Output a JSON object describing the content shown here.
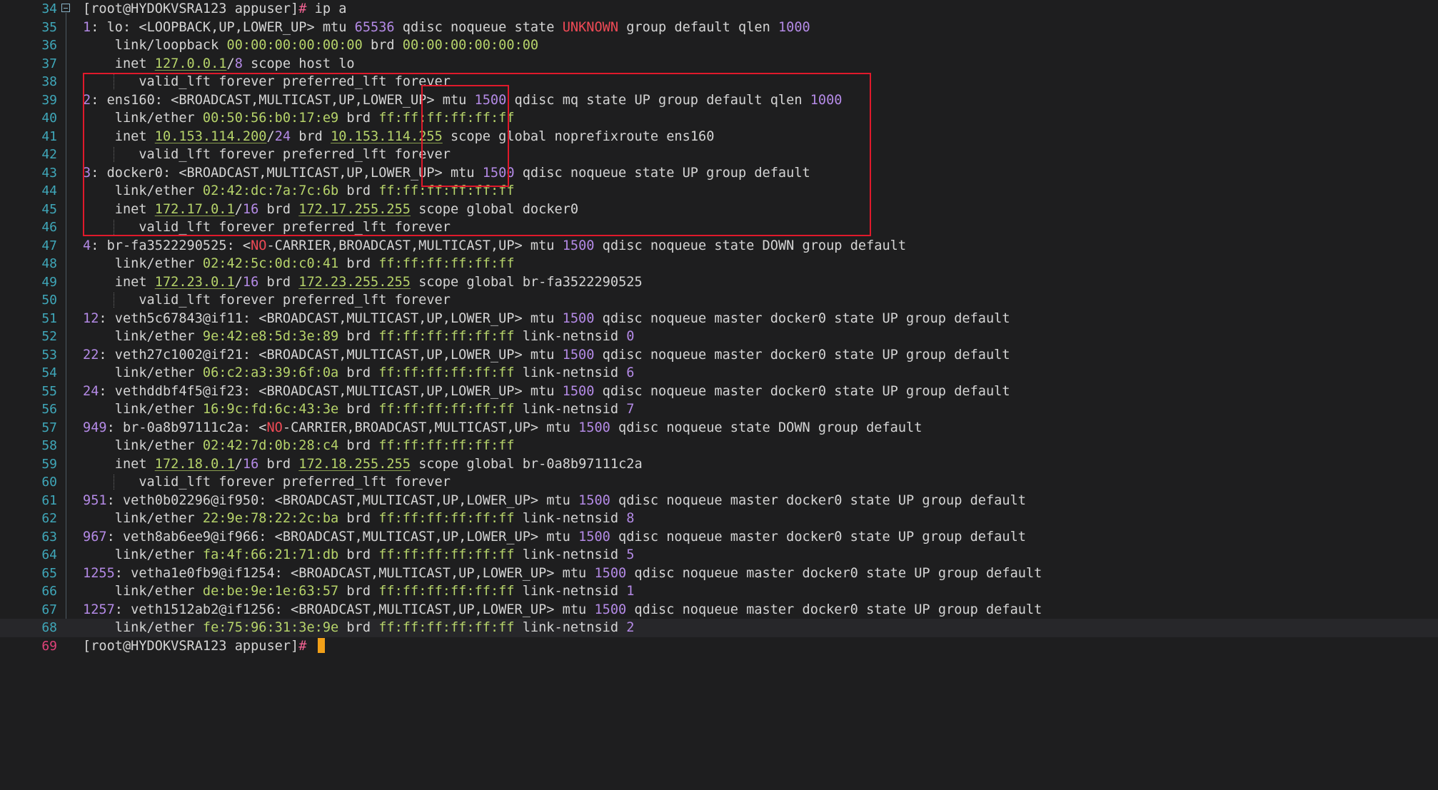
{
  "editor": {
    "first_line_number": 34,
    "current_line": 69,
    "highlight_line": 68,
    "lines": [
      [
        [
          "[root@HYDOKVSRA123 appuser]",
          "plain"
        ],
        [
          "# ",
          "pink"
        ],
        [
          "ip a",
          "plain"
        ]
      ],
      [
        [
          "1",
          "num"
        ],
        [
          ": lo: <LOOPBACK,UP,LOWER_UP> mtu ",
          "plain"
        ],
        [
          "65536",
          "num"
        ],
        [
          " qdisc noqueue state ",
          "plain"
        ],
        [
          "UNKNOWN",
          "red"
        ],
        [
          " group default qlen ",
          "plain"
        ],
        [
          "1000",
          "num"
        ]
      ],
      [
        [
          "    link/loopback ",
          "plain"
        ],
        [
          "00:00:00:00:00:00",
          "mac"
        ],
        [
          " brd ",
          "plain"
        ],
        [
          "00:00:00:00:00:00",
          "mac"
        ]
      ],
      [
        [
          "    inet ",
          "plain"
        ],
        [
          "127.0.0.1",
          "ip"
        ],
        [
          "/",
          "plain"
        ],
        [
          "8",
          "num"
        ],
        [
          " scope host lo",
          "plain"
        ]
      ],
      [
        [
          "       valid_lft forever preferred_lft forever",
          "plain"
        ]
      ],
      [
        [
          "2",
          "num"
        ],
        [
          ": ens160: <BROADCAST,MULTICAST,UP,LOWER_UP> mtu ",
          "plain"
        ],
        [
          "1500",
          "num"
        ],
        [
          " qdisc mq state UP group default qlen ",
          "plain"
        ],
        [
          "1000",
          "num"
        ]
      ],
      [
        [
          "    link/ether ",
          "plain"
        ],
        [
          "00:50:56:b0:17:e9",
          "mac"
        ],
        [
          " brd ",
          "plain"
        ],
        [
          "ff:ff:ff:ff:ff:ff",
          "mac"
        ]
      ],
      [
        [
          "    inet ",
          "plain"
        ],
        [
          "10.153.114.200",
          "ip"
        ],
        [
          "/",
          "plain"
        ],
        [
          "24",
          "num"
        ],
        [
          " brd ",
          "plain"
        ],
        [
          "10.153.114.255",
          "ip"
        ],
        [
          " scope global noprefixroute ens160",
          "plain"
        ]
      ],
      [
        [
          "       valid_lft forever preferred_lft forever",
          "plain"
        ]
      ],
      [
        [
          "3",
          "num"
        ],
        [
          ": docker0: <BROADCAST,MULTICAST,UP,LOWER_UP> mtu ",
          "plain"
        ],
        [
          "1500",
          "num"
        ],
        [
          " qdisc noqueue state UP group default",
          "plain"
        ]
      ],
      [
        [
          "    link/ether ",
          "plain"
        ],
        [
          "02:42:dc:7a:7c:6b",
          "mac"
        ],
        [
          " brd ",
          "plain"
        ],
        [
          "ff:ff:ff:ff:ff:ff",
          "mac"
        ]
      ],
      [
        [
          "    inet ",
          "plain"
        ],
        [
          "172.17.0.1",
          "ip"
        ],
        [
          "/",
          "plain"
        ],
        [
          "16",
          "num"
        ],
        [
          " brd ",
          "plain"
        ],
        [
          "172.17.255.255",
          "ip"
        ],
        [
          " scope global docker0",
          "plain"
        ]
      ],
      [
        [
          "       valid_lft forever preferred_lft forever",
          "plain"
        ]
      ],
      [
        [
          "4",
          "num"
        ],
        [
          ": br-fa3522290525: <",
          "plain"
        ],
        [
          "NO",
          "red"
        ],
        [
          "-CARRIER,BROADCAST,MULTICAST,UP> mtu ",
          "plain"
        ],
        [
          "1500",
          "num"
        ],
        [
          " qdisc noqueue state DOWN group default",
          "plain"
        ]
      ],
      [
        [
          "    link/ether ",
          "plain"
        ],
        [
          "02:42:5c:0d:c0:41",
          "mac"
        ],
        [
          " brd ",
          "plain"
        ],
        [
          "ff:ff:ff:ff:ff:ff",
          "mac"
        ]
      ],
      [
        [
          "    inet ",
          "plain"
        ],
        [
          "172.23.0.1",
          "ip"
        ],
        [
          "/",
          "plain"
        ],
        [
          "16",
          "num"
        ],
        [
          " brd ",
          "plain"
        ],
        [
          "172.23.255.255",
          "ip"
        ],
        [
          " scope global br-fa3522290525",
          "plain"
        ]
      ],
      [
        [
          "       valid_lft forever preferred_lft forever",
          "plain"
        ]
      ],
      [
        [
          "12",
          "num"
        ],
        [
          ": veth5c67843@if11: <BROADCAST,MULTICAST,UP,LOWER_UP> mtu ",
          "plain"
        ],
        [
          "1500",
          "num"
        ],
        [
          " qdisc noqueue master docker0 state UP group default",
          "plain"
        ]
      ],
      [
        [
          "    link/ether ",
          "plain"
        ],
        [
          "9e:42:e8:5d:3e:89",
          "mac"
        ],
        [
          " brd ",
          "plain"
        ],
        [
          "ff:ff:ff:ff:ff:ff",
          "mac"
        ],
        [
          " link-netnsid ",
          "plain"
        ],
        [
          "0",
          "num"
        ]
      ],
      [
        [
          "22",
          "num"
        ],
        [
          ": veth27c1002@if21: <BROADCAST,MULTICAST,UP,LOWER_UP> mtu ",
          "plain"
        ],
        [
          "1500",
          "num"
        ],
        [
          " qdisc noqueue master docker0 state UP group default",
          "plain"
        ]
      ],
      [
        [
          "    link/ether ",
          "plain"
        ],
        [
          "06:c2:a3:39:6f:0a",
          "mac"
        ],
        [
          " brd ",
          "plain"
        ],
        [
          "ff:ff:ff:ff:ff:ff",
          "mac"
        ],
        [
          " link-netnsid ",
          "plain"
        ],
        [
          "6",
          "num"
        ]
      ],
      [
        [
          "24",
          "num"
        ],
        [
          ": vethddbf4f5@if23: <BROADCAST,MULTICAST,UP,LOWER_UP> mtu ",
          "plain"
        ],
        [
          "1500",
          "num"
        ],
        [
          " qdisc noqueue master docker0 state UP group default",
          "plain"
        ]
      ],
      [
        [
          "    link/ether ",
          "plain"
        ],
        [
          "16:9c:fd:6c:43:3e",
          "mac"
        ],
        [
          " brd ",
          "plain"
        ],
        [
          "ff:ff:ff:ff:ff:ff",
          "mac"
        ],
        [
          " link-netnsid ",
          "plain"
        ],
        [
          "7",
          "num"
        ]
      ],
      [
        [
          "949",
          "num"
        ],
        [
          ": br-0a8b97111c2a: <",
          "plain"
        ],
        [
          "NO",
          "red"
        ],
        [
          "-CARRIER,BROADCAST,MULTICAST,UP> mtu ",
          "plain"
        ],
        [
          "1500",
          "num"
        ],
        [
          " qdisc noqueue state DOWN group default",
          "plain"
        ]
      ],
      [
        [
          "    link/ether ",
          "plain"
        ],
        [
          "02:42:7d:0b:28:c4",
          "mac"
        ],
        [
          " brd ",
          "plain"
        ],
        [
          "ff:ff:ff:ff:ff:ff",
          "mac"
        ]
      ],
      [
        [
          "    inet ",
          "plain"
        ],
        [
          "172.18.0.1",
          "ip"
        ],
        [
          "/",
          "plain"
        ],
        [
          "16",
          "num"
        ],
        [
          " brd ",
          "plain"
        ],
        [
          "172.18.255.255",
          "ip"
        ],
        [
          " scope global br-0a8b97111c2a",
          "plain"
        ]
      ],
      [
        [
          "       valid_lft forever preferred_lft forever",
          "plain"
        ]
      ],
      [
        [
          "951",
          "num"
        ],
        [
          ": veth0b02296@if950: <BROADCAST,MULTICAST,UP,LOWER_UP> mtu ",
          "plain"
        ],
        [
          "1500",
          "num"
        ],
        [
          " qdisc noqueue master docker0 state UP group default",
          "plain"
        ]
      ],
      [
        [
          "    link/ether ",
          "plain"
        ],
        [
          "22:9e:78:22:2c:ba",
          "mac"
        ],
        [
          " brd ",
          "plain"
        ],
        [
          "ff:ff:ff:ff:ff:ff",
          "mac"
        ],
        [
          " link-netnsid ",
          "plain"
        ],
        [
          "8",
          "num"
        ]
      ],
      [
        [
          "967",
          "num"
        ],
        [
          ": veth8ab6ee9@if966: <BROADCAST,MULTICAST,UP,LOWER_UP> mtu ",
          "plain"
        ],
        [
          "1500",
          "num"
        ],
        [
          " qdisc noqueue master docker0 state UP group default",
          "plain"
        ]
      ],
      [
        [
          "    link/ether ",
          "plain"
        ],
        [
          "fa:4f:66:21:71:db",
          "mac"
        ],
        [
          " brd ",
          "plain"
        ],
        [
          "ff:ff:ff:ff:ff:ff",
          "mac"
        ],
        [
          " link-netnsid ",
          "plain"
        ],
        [
          "5",
          "num"
        ]
      ],
      [
        [
          "1255",
          "num"
        ],
        [
          ": vetha1e0fb9@if1254: <BROADCAST,MULTICAST,UP,LOWER_UP> mtu ",
          "plain"
        ],
        [
          "1500",
          "num"
        ],
        [
          " qdisc noqueue master docker0 state UP group default",
          "plain"
        ]
      ],
      [
        [
          "    link/ether ",
          "plain"
        ],
        [
          "de:be:9e:1e:63:57",
          "mac"
        ],
        [
          " brd ",
          "plain"
        ],
        [
          "ff:ff:ff:ff:ff:ff",
          "mac"
        ],
        [
          " link-netnsid ",
          "plain"
        ],
        [
          "1",
          "num"
        ]
      ],
      [
        [
          "1257",
          "num"
        ],
        [
          ": veth1512ab2@if1256: <BROADCAST,MULTICAST,UP,LOWER_UP> mtu ",
          "plain"
        ],
        [
          "1500",
          "num"
        ],
        [
          " qdisc noqueue master docker0 state UP group default",
          "plain"
        ]
      ],
      [
        [
          "    link/ether ",
          "plain"
        ],
        [
          "fe:75:96:31:3e:9e",
          "mac"
        ],
        [
          " brd ",
          "plain"
        ],
        [
          "ff:ff:ff:ff:ff:ff",
          "mac"
        ],
        [
          " link-netnsid ",
          "plain"
        ],
        [
          "2",
          "num"
        ]
      ],
      [
        [
          "[root@HYDOKVSRA123 appuser]",
          "plain"
        ],
        [
          "# ",
          "pink"
        ]
      ]
    ]
  },
  "colors": {
    "background": "#1e1e1f",
    "text": "#d4d4d4",
    "number": "#b48ae6",
    "mac_ip": "#b6d36a",
    "error_red": "#f04a56",
    "prompt_hash": "#f06292",
    "line_number": "#3fa7b9",
    "current_line_number": "#e0427a",
    "highlight_box": "#e0192b",
    "cursor": "#f2a018"
  },
  "icons": {
    "fold_marker": "collapse-minus-icon"
  }
}
